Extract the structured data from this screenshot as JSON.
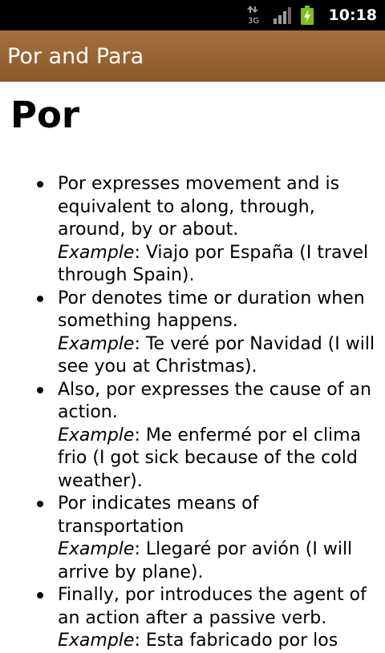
{
  "status_bar": {
    "network_label": "3G",
    "time": "10:18"
  },
  "app_bar": {
    "title": "Por and Para"
  },
  "content": {
    "heading": "Por",
    "example_label": "Example",
    "items": [
      {
        "text": "Por expresses movement and is equivalent to along, through, around, by or about.",
        "example": ": Viajo por España (I travel through Spain)."
      },
      {
        "text": "Por denotes time or duration when something happens.",
        "example": ": Te veré por Navidad (I will see you at Christmas)."
      },
      {
        "text": "Also, por expresses the cause of an action.",
        "example": ": Me enfermé por el clima frio (I got sick because of the cold weather)."
      },
      {
        "text": "Por indicates means of transportation",
        "example": ": Llegaré por avión (I will arrive by plane)."
      },
      {
        "text": "Finally, por introduces the agent of an action after a passive verb.",
        "example": ": Esta fabricado por los"
      }
    ]
  }
}
